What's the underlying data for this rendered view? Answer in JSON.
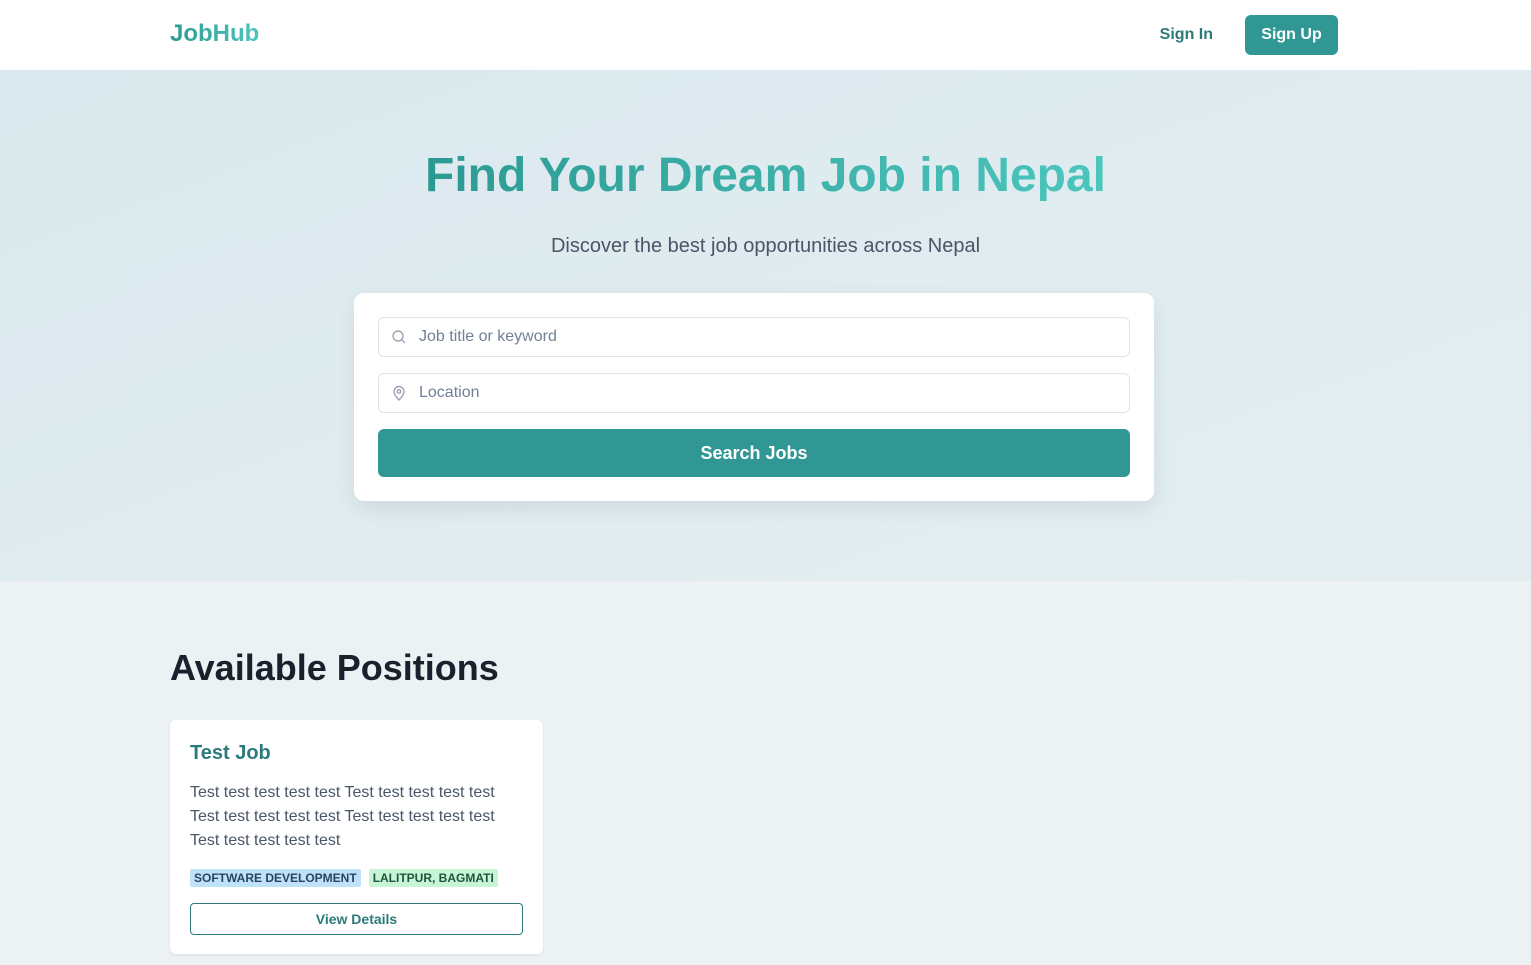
{
  "nav": {
    "brand": "JobHub",
    "sign_in": "Sign In",
    "sign_up": "Sign Up"
  },
  "hero": {
    "title": "Find Your Dream Job in Nepal",
    "subtitle": "Discover the best job opportunities across Nepal"
  },
  "search": {
    "keyword_placeholder": "Job title or keyword",
    "location_placeholder": "Location",
    "button_label": "Search Jobs",
    "keyword_icon": "search-icon",
    "location_icon": "map-pin-icon"
  },
  "positions": {
    "heading": "Available Positions",
    "jobs": [
      {
        "title": "Test Job",
        "description": "Test test test test test Test test test test test Test test test test test Test test test test test Test test test test test",
        "category": "SOFTWARE DEVELOPMENT",
        "location": "LALITPUR, BAGMATI",
        "action": "View Details"
      }
    ]
  },
  "colors": {
    "accent": "#319795",
    "accent_text": "#2c7a7b",
    "gradient_start": "#2c9a92",
    "gradient_end": "#4cc6bd"
  }
}
